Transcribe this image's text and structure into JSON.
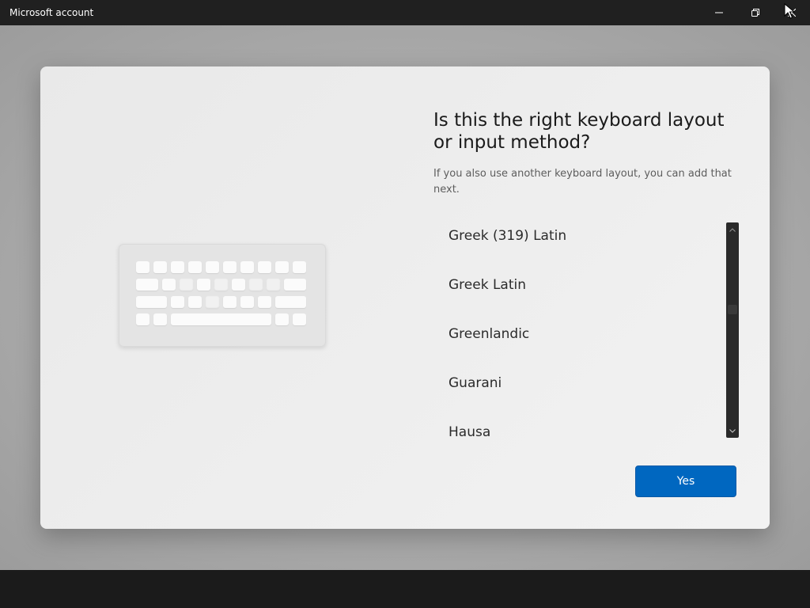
{
  "window": {
    "title": "Microsoft account",
    "controls": {
      "minimize_icon": "minimize-icon",
      "restore_icon": "restore-icon",
      "close_icon": "close-icon"
    }
  },
  "setup": {
    "heading": "Is this the right keyboard layout or input method?",
    "subtext": "If you also use another keyboard layout, you can add that next.",
    "layouts": [
      "Greek (319) Latin",
      "Greek Latin",
      "Greenlandic",
      "Guarani",
      "Hausa"
    ],
    "yes_label": "Yes"
  },
  "colors": {
    "accent": "#0067c0",
    "titlebar": "#202020",
    "card": "#eeeeee"
  }
}
